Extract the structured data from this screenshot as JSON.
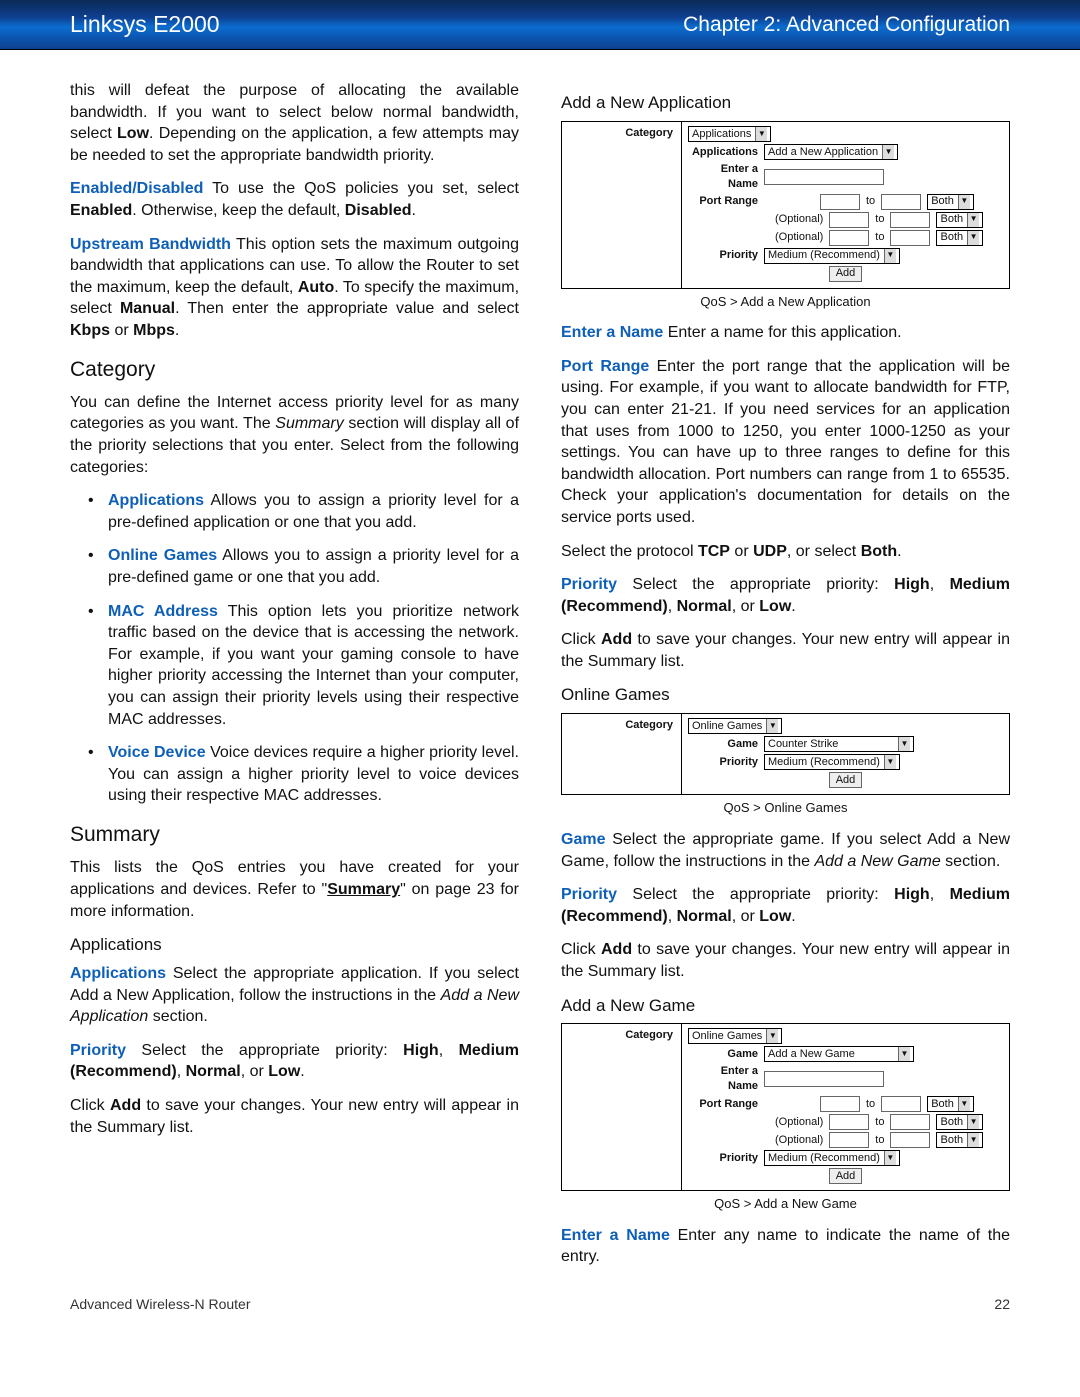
{
  "header": {
    "product": "Linksys E2000",
    "chapter": "Chapter 2: Advanced Configuration"
  },
  "col1": {
    "intro": "this will defeat the purpose of allocating the available bandwidth. If you want to select below normal bandwidth, select ",
    "intro_bold": "Low",
    "intro_after": ". Depending on the application, a few attempts may be needed to set the appropriate bandwidth priority.",
    "enabled_label": "Enabled/Disabled",
    "enabled_text": "  To use the QoS policies you set, select ",
    "enabled_bold": "Enabled",
    "enabled_after": ". Otherwise, keep the default, ",
    "disabled_bold": "Disabled",
    "upstream_label": "Upstream Bandwidth",
    "upstream_text": " This option sets the maximum outgoing bandwidth that applications can use. To allow the Router to set the maximum, keep the default, ",
    "auto_bold": "Auto",
    "upstream_after": ". To specify the maximum, select ",
    "manual_bold": "Manual",
    "upstream_tail": ". Then enter the appropriate value and select ",
    "kbps_bold": "Kbps",
    "or": " or ",
    "mbps_bold": "Mbps",
    "category_h": "Category",
    "category_text": "You can define the Internet access priority level for as many categories as you want. The ",
    "summary_italic": "Summary",
    "category_after": " section will display all of the priority selections that you enter. Select from the following categories:",
    "bullets": {
      "apps_label": "Applications",
      "apps_text": "  Allows you to assign a priority level for a pre-defined application or one that you add.",
      "games_label": "Online Games",
      "games_text": "  Allows you to assign a priority level for a pre-defined game or one that you add.",
      "mac_label": "MAC Address",
      "mac_text": "  This option lets you prioritize network traffic based on the device that is accessing the network. For example, if you want your gaming console to have higher priority accessing the Internet than your computer, you can assign their priority levels using their respective MAC addresses.",
      "voice_label": "Voice Device",
      "voice_text": "  Voice devices require a higher priority level. You can assign a higher priority level to voice devices using their respective MAC addresses."
    },
    "summary_h": "Summary",
    "summary_text": "This lists the QoS entries you have created for your applications and devices. Refer to \"",
    "summary_link": "Summary",
    "summary_after": "\" on page 23 for more information.",
    "applications_h": "Applications",
    "apps_p_label": "Applications",
    "apps_p_text": "  Select the appropriate application. If you select Add a New Application, follow the instructions in the ",
    "apps_italic": "Add a New Application",
    "apps_p_after": " section.",
    "priority_label": "Priority",
    "priority_text": "  Select the appropriate priority: ",
    "high_bold": "High",
    "comma": ", ",
    "medium_bold": "Medium (Recommend)",
    "normal_bold": "Normal",
    "or2": ", or ",
    "low_bold": "Low",
    "click_add_text": "Click ",
    "add_bold": "Add",
    "click_add_after": " to save your changes. Your new entry will appear in the Summary list."
  },
  "col2": {
    "add_app_h": "Add a New Application",
    "fig1": {
      "category_lbl": "Category",
      "applications_lbl": "Applications",
      "applications_dd": "Applications",
      "addnew_dd": "Add a New Application",
      "entername_lbl": "Enter a Name",
      "portrange_lbl": "Port Range",
      "optional": "(Optional)",
      "to": "to",
      "both_dd": "Both",
      "priority_lbl": "Priority",
      "priority_dd": "Medium (Recommend)",
      "add_btn": "Add"
    },
    "caption1": "QoS > Add a New Application",
    "entername_label": "Enter a Name",
    "entername_text": "  Enter a name for this application.",
    "portrange_label": "Port Range",
    "portrange_text": "  Enter the port range that the application will be using. For example, if you want to allocate bandwidth for FTP, you can enter 21-21. If you need services for an application that uses from 1000 to 1250, you enter 1000-1250 as your settings. You can have up to three ranges to define for this bandwidth allocation. Port numbers can range from 1 to 65535. Check your application's documentation for details on the service ports used.",
    "protocol_text": "Select the protocol ",
    "tcp_bold": "TCP",
    "or": " or ",
    "udp_bold": "UDP",
    "protocol_after": ", or select ",
    "both_bold": "Both",
    "priority_label": "Priority",
    "priority_text": "  Select the appropriate priority: ",
    "high_bold": "High",
    "comma": ", ",
    "medium_bold": "Medium (Recommend)",
    "normal_bold": "Normal",
    "or2": ", or ",
    "low_bold": "Low",
    "click_add_text": "Click ",
    "add_bold": "Add",
    "click_add_after": " to save your changes. Your new entry will appear in the Summary list.",
    "online_games_h": "Online Games",
    "fig2": {
      "category_lbl": "Category",
      "category_dd": "Online Games",
      "game_lbl": "Game",
      "game_dd": "Counter Strike",
      "priority_lbl": "Priority",
      "priority_dd": "Medium (Recommend)",
      "add_btn": "Add"
    },
    "caption2": "QoS > Online Games",
    "game_label": "Game",
    "game_text": "  Select the appropriate game. If you select Add a New Game, follow the instructions in the ",
    "game_italic": "Add a New Game",
    "game_after": " section.",
    "add_game_h": "Add a New Game",
    "fig3": {
      "category_lbl": "Category",
      "category_dd": "Online Games",
      "game_lbl": "Game",
      "game_dd": "Add a New Game",
      "entername_lbl": "Enter a Name",
      "portrange_lbl": "Port Range",
      "optional": "(Optional)",
      "to": "to",
      "both_dd": "Both",
      "priority_lbl": "Priority",
      "priority_dd": "Medium (Recommend)",
      "add_btn": "Add"
    },
    "caption3": "QoS > Add a New Game",
    "entername2_label": "Enter a Name",
    "entername2_text": "  Enter any name to indicate the name of the entry."
  },
  "footer": {
    "left": "Advanced Wireless-N Router",
    "right": "22"
  }
}
